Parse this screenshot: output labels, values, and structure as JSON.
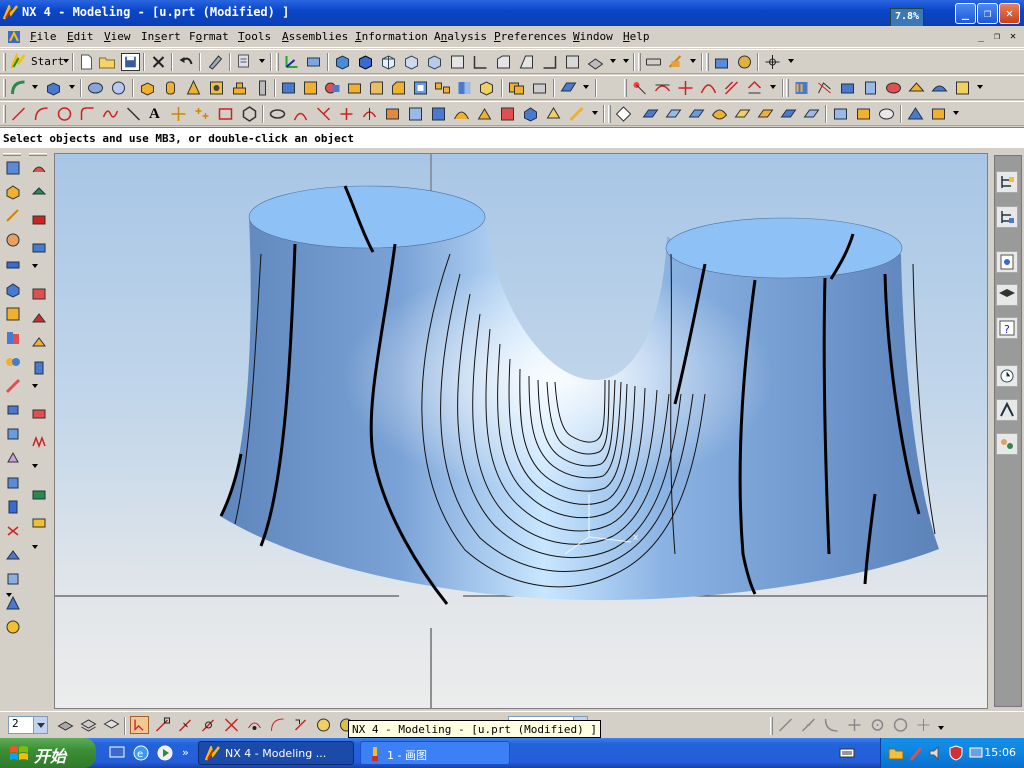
{
  "window": {
    "title": "NX 4 - Modeling - [u.prt (Modified) ]",
    "perf_meter": "7.8%",
    "perf_fraction": 0.078,
    "buttons": [
      "minimize",
      "maximize",
      "close"
    ]
  },
  "menubar": {
    "items": [
      {
        "key": "F",
        "rest": "ile"
      },
      {
        "key": "E",
        "rest": "dit"
      },
      {
        "key": "V",
        "rest": "iew"
      },
      {
        "key": "s",
        "pre": "In",
        "rest": "ert"
      },
      {
        "key": "o",
        "pre": "F",
        "rest": "rmat"
      },
      {
        "key": "T",
        "rest": "ools"
      },
      {
        "key": "A",
        "rest": "ssemblies"
      },
      {
        "key": "I",
        "rest": "nformation"
      },
      {
        "key": "n",
        "pre": "A",
        "rest": "alysis"
      },
      {
        "key": "P",
        "rest": "references"
      },
      {
        "key": "W",
        "rest": "indow"
      },
      {
        "key": "H",
        "rest": "elp"
      }
    ],
    "labels": [
      "File",
      "Edit",
      "View",
      "Insert",
      "Format",
      "Tools",
      "Assemblies",
      "Information",
      "Analysis",
      "Preferences",
      "Window",
      "Help"
    ]
  },
  "toolbar1": {
    "start_label": "Start"
  },
  "toolbar3": {
    "text_tool": "A"
  },
  "status": {
    "prompt": "Select objects and use MB3, or double-click an object"
  },
  "bottombar": {
    "layer_value": "2"
  },
  "tooltip": {
    "text": "NX 4 - Modeling - [u.prt (Modified) ]"
  },
  "taskbar": {
    "start_label": "开始",
    "tasks": [
      {
        "label": "NX 4 - Modeling ...",
        "active": true
      },
      {
        "label": "1 - 画图",
        "active": false
      }
    ],
    "clock": "15:06"
  },
  "colors": {
    "title_blue": "#0a46c8",
    "surface_blue": "#6f9ad0",
    "viewport_top": "#a8c6e6",
    "taskbar_blue": "#245edb",
    "start_green": "#3c8f36"
  }
}
